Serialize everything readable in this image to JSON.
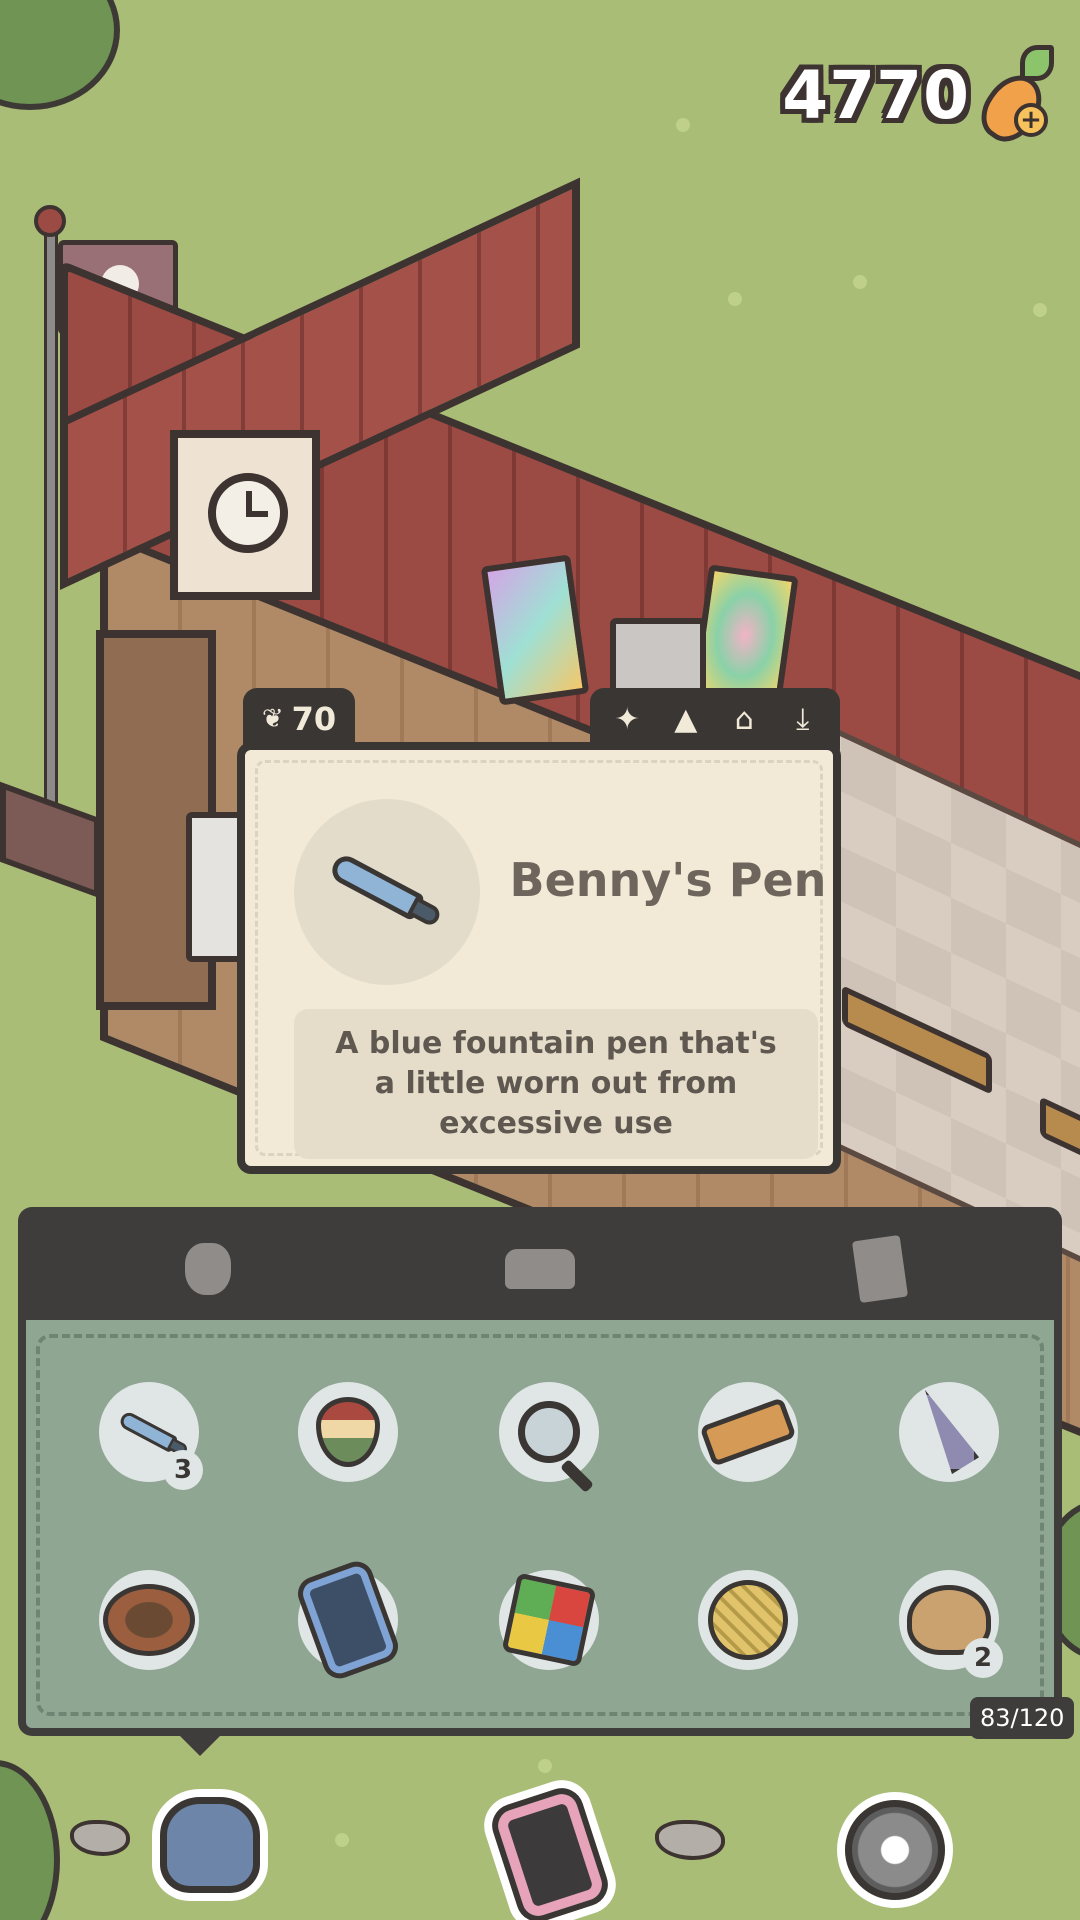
{
  "hud": {
    "currency_value": "4770",
    "currency_icon": "carrot-plus-icon"
  },
  "popup": {
    "price": "70",
    "price_icon": "carrot-icon",
    "actions": [
      "sparkle-icon",
      "terrain-icon",
      "home-icon",
      "place-icon"
    ],
    "item_name": "Benny's Pen",
    "item_icon": "blue-pen-icon",
    "item_description": "A blue fountain pen that's a little worn out from excessive use"
  },
  "inventory": {
    "tabs": [
      "bag-icon",
      "sofa-icon",
      "seed-packet-icon"
    ],
    "capacity": "83/120",
    "items": [
      {
        "icon": "blue-pen-icon",
        "count": "3"
      },
      {
        "icon": "spinning-top-icon",
        "count": ""
      },
      {
        "icon": "magnifying-glass-icon",
        "count": ""
      },
      {
        "icon": "brush-icon",
        "count": ""
      },
      {
        "icon": "umbrella-icon",
        "count": ""
      },
      {
        "icon": "bowl-icon",
        "count": ""
      },
      {
        "icon": "phone-icon",
        "count": ""
      },
      {
        "icon": "rubiks-cube-icon",
        "count": ""
      },
      {
        "icon": "yarn-ball-icon",
        "count": ""
      },
      {
        "icon": "hermit-crab-icon",
        "count": "2"
      }
    ]
  },
  "toolbar": {
    "buttons": [
      "backpack-icon",
      "phone-icon",
      "settings-gear-icon"
    ]
  },
  "colors": {
    "grass": "#a9bd77",
    "panel_dark": "#3f3d3b",
    "inventory_bg": "#8fa692",
    "popup_bg": "#f2ead7",
    "text_muted": "#6e665c"
  }
}
